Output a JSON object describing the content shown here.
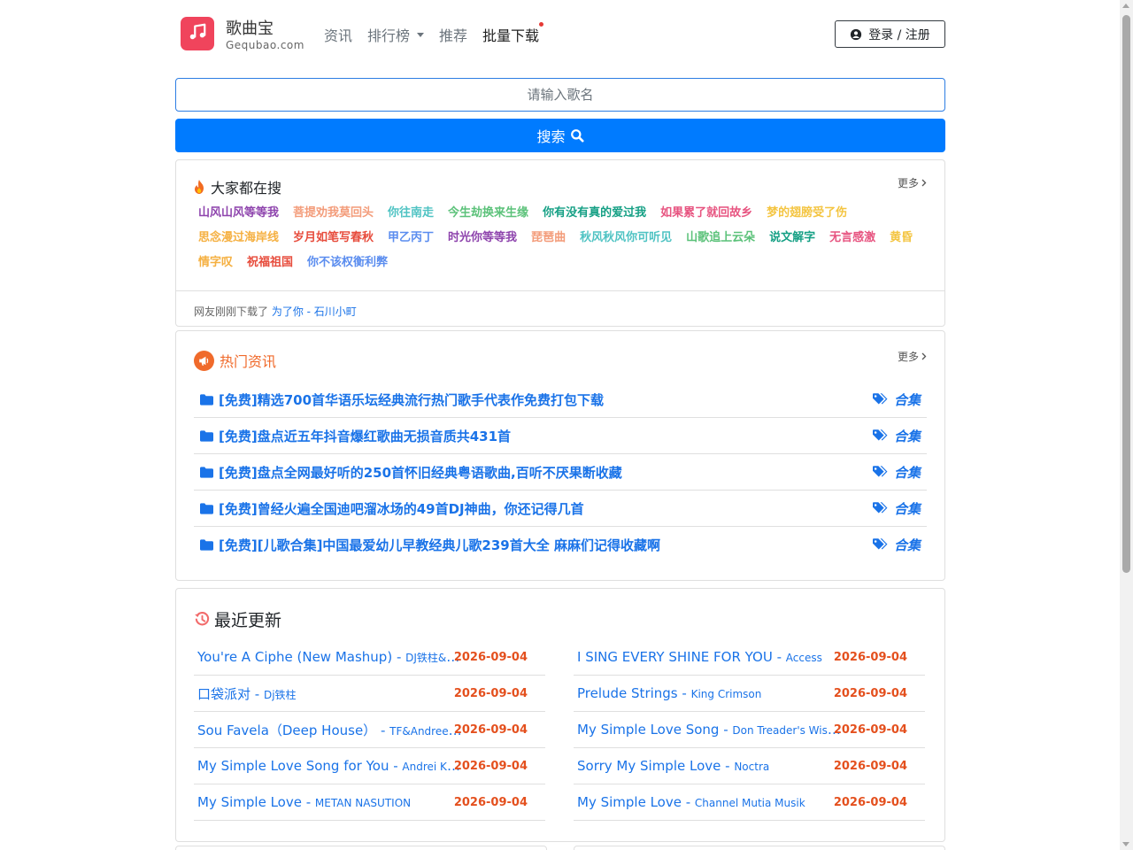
{
  "header": {
    "logo_name": "歌曲宝",
    "logo_sub": "Gequbao.com",
    "nav": [
      {
        "label": "资讯"
      },
      {
        "label": "排行榜"
      },
      {
        "label": "推荐"
      },
      {
        "label": "批量下载"
      }
    ],
    "login_label": "登录 / 注册"
  },
  "search": {
    "placeholder": "请输入歌名",
    "button_label": "搜索"
  },
  "hot_search": {
    "title": "大家都在搜",
    "more": "更多",
    "tags": [
      {
        "text": "山风山风等等我",
        "color": "#8e44ad"
      },
      {
        "text": "菩提劝我莫回头",
        "color": "#f39c7a"
      },
      {
        "text": "你往南走",
        "color": "#4fc3c3"
      },
      {
        "text": "今生劫换来生缘",
        "color": "#5cc27a"
      },
      {
        "text": "你有没有真的爱过我",
        "color": "#16a085"
      },
      {
        "text": "如果累了就回故乡",
        "color": "#e75480"
      },
      {
        "text": "梦的翅膀受了伤",
        "color": "#f4c542"
      },
      {
        "text": "思念漫过海岸线",
        "color": "#f5b041"
      },
      {
        "text": "岁月如笔写春秋",
        "color": "#e74c3c"
      },
      {
        "text": "甲乙丙丁",
        "color": "#5b8def"
      },
      {
        "text": "时光你等等我",
        "color": "#8e44ad"
      },
      {
        "text": "琵琶曲",
        "color": "#f39c7a"
      },
      {
        "text": "秋风秋风你可听见",
        "color": "#4fc3c3"
      },
      {
        "text": "山歌追上云朵",
        "color": "#5cc27a"
      },
      {
        "text": "说文解字",
        "color": "#16a085"
      },
      {
        "text": "无言感激",
        "color": "#e75480"
      },
      {
        "text": "黄昏",
        "color": "#f4c542"
      },
      {
        "text": "情字叹",
        "color": "#f5b041"
      },
      {
        "text": "祝福祖国",
        "color": "#e74c3c"
      },
      {
        "text": "你不该权衡利弊",
        "color": "#5b8def"
      }
    ],
    "footer_prefix": "网友刚刚下载了",
    "footer_link": "为了你 - 石川小町"
  },
  "news": {
    "title": "热门资讯",
    "more": "更多",
    "items": [
      {
        "title": "[免费]精选700首华语乐坛经典流行热门歌手代表作免费打包下载",
        "tag": "合集"
      },
      {
        "title": "[免费]盘点近五年抖音爆红歌曲无损音质共431首",
        "tag": "合集"
      },
      {
        "title": "[免费]盘点全网最好听的250首怀旧经典粤语歌曲,百听不厌果断收藏",
        "tag": "合集"
      },
      {
        "title": "[免费]曾经火遍全国迪吧溜冰场的49首DJ神曲，你还记得几首",
        "tag": "合集"
      },
      {
        "title": "[免费][儿歌合集]中国最爱幼儿早教经典儿歌239首大全 麻麻们记得收藏啊",
        "tag": "合集"
      }
    ]
  },
  "recent": {
    "title": "最近更新",
    "left": [
      {
        "song": "You're A Ciphe (New Mashup)",
        "artist": "DJ铁柱&阳...",
        "date": "2026-09-04"
      },
      {
        "song": "口袋派对",
        "artist": "Dj铁柱",
        "date": "2026-09-04"
      },
      {
        "song": "Sou Favela（Deep House）",
        "artist": "TF&Andree S...",
        "date": "2026-09-04"
      },
      {
        "song": "My Simple Love Song for You",
        "artist": "Andrei Krylov",
        "date": "2026-09-04"
      },
      {
        "song": "My Simple Love",
        "artist": "METAN NASUTION",
        "date": "2026-09-04"
      }
    ],
    "right": [
      {
        "song": "I SING EVERY SHINE FOR YOU",
        "artist": "Access",
        "date": "2026-09-04"
      },
      {
        "song": "Prelude Strings",
        "artist": "King Crimson",
        "date": "2026-09-04"
      },
      {
        "song": "My Simple Love Song",
        "artist": "Don Treader's Wisdo...",
        "date": "2026-09-04"
      },
      {
        "song": "Sorry My Simple Love",
        "artist": "Noctra",
        "date": "2026-09-04"
      },
      {
        "song": "My Simple Love",
        "artist": "Channel Mutia Musik",
        "date": "2026-09-04"
      }
    ]
  },
  "colors": {
    "primary": "#007bff",
    "link": "#1a73e8",
    "date": "#e4501e",
    "logo": "#f0445c",
    "news_title": "#f06a2b"
  }
}
